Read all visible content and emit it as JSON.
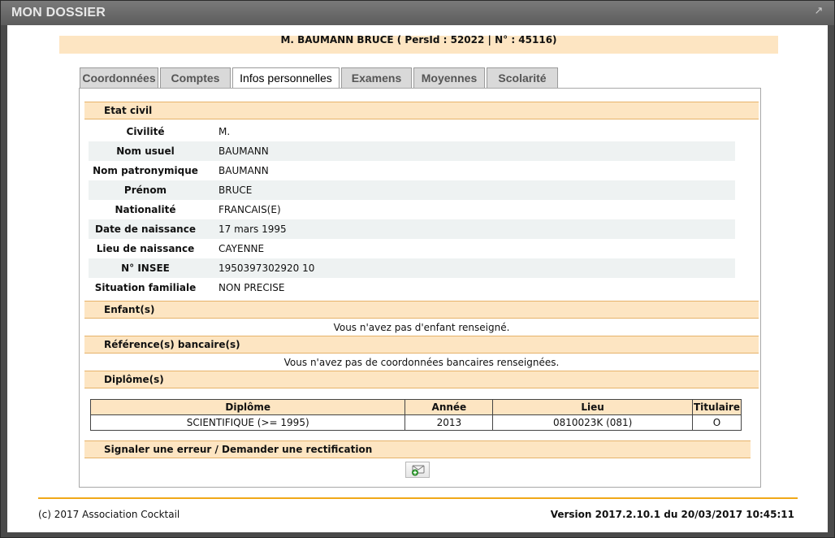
{
  "window": {
    "title": "MON DOSSIER"
  },
  "banner": {
    "text": "M. BAUMANN BRUCE ( PersId : 52022 | N° : 45116)"
  },
  "tabs": [
    {
      "label": "Coordonnées",
      "active": false
    },
    {
      "label": "Comptes",
      "active": false
    },
    {
      "label": "Infos personnelles",
      "active": true
    },
    {
      "label": "Examens",
      "active": false
    },
    {
      "label": "Moyennes",
      "active": false
    },
    {
      "label": "Scolarité",
      "active": false
    }
  ],
  "etat_civil": {
    "header": "Etat civil",
    "rows": [
      {
        "label": "Civilité",
        "value": "M."
      },
      {
        "label": "Nom usuel",
        "value": "BAUMANN"
      },
      {
        "label": "Nom patronymique",
        "value": "BAUMANN"
      },
      {
        "label": "Prénom",
        "value": "BRUCE"
      },
      {
        "label": "Nationalité",
        "value": "FRANCAIS(E)"
      },
      {
        "label": "Date de naissance",
        "value": "17 mars 1995"
      },
      {
        "label": "Lieu de naissance",
        "value": "CAYENNE"
      },
      {
        "label": "N° INSEE",
        "value": "1950397302920  10"
      },
      {
        "label": "Situation familiale",
        "value": "NON PRECISE"
      }
    ]
  },
  "enfants": {
    "header": "Enfant(s)",
    "message": "Vous n'avez pas d'enfant renseigné."
  },
  "banque": {
    "header": "Référence(s) bancaire(s)",
    "message": "Vous n'avez pas de coordonnées bancaires renseignées."
  },
  "diplomes": {
    "header": "Diplôme(s)",
    "columns": [
      "Diplôme",
      "Année",
      "Lieu",
      "Titulaire"
    ],
    "rows": [
      [
        "SCIENTIFIQUE (>= 1995)",
        "2013",
        "0810023K (081)",
        "O"
      ]
    ]
  },
  "rectification": {
    "header": "Signaler une erreur / Demander une rectification",
    "icon": "envelope-add-icon"
  },
  "footer": {
    "left": "(c) 2017 Association Cocktail",
    "right": "Version 2017.2.10.1 du 20/03/2017 10:45:11"
  },
  "colors": {
    "accent": "#f0a818",
    "section_bg": "#fde5c2",
    "row_shade": "#eef2f2"
  }
}
